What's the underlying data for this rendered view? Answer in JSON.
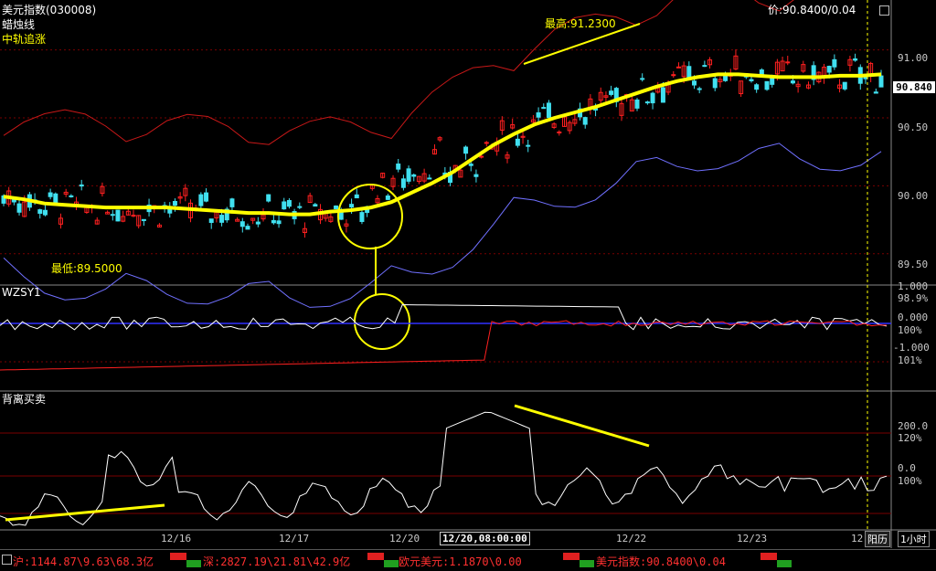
{
  "colors": {
    "bg": "#000000",
    "up": "#ff2020",
    "down": "#40e0f0",
    "ma": "#ffff00",
    "upper_band": "#c81818",
    "lower_band": "#7070ff",
    "indicator_white": "#ffffff",
    "highlight": "#ffff00",
    "grid": "#7a0000"
  },
  "header": {
    "title": "美元指数(030008)",
    "sub1": "蜡烛线",
    "sub2": "中轨追涨",
    "price": "价:90.8400/0.04"
  },
  "annotations": {
    "high": "最高:91.2300",
    "low": "最低:89.5000"
  },
  "current_price_tag": "90.840",
  "panel2": {
    "title": "WZSY1",
    "ticks": [
      "1.000",
      "98.9%",
      "0.000",
      "100%",
      "-1.000",
      "101%"
    ]
  },
  "panel3": {
    "title": "背离买卖",
    "ticks": [
      "200.0",
      "120%",
      "0.0",
      "100%"
    ]
  },
  "bottom_right": {
    "period_btn": "阳历",
    "period": "1小时"
  },
  "statusbar": [
    {
      "text": "沪:1144.87\\9.63\\68.3亿",
      "icon": "market-icon"
    },
    {
      "text": "深:2827.19\\21.81\\42.9亿",
      "icon": "market-icon"
    },
    {
      "text": "欧元美元:1.1870\\0.00",
      "icon": "market-icon"
    },
    {
      "text": "美元指数:90.8400\\0.04",
      "icon": "market-icon"
    }
  ],
  "chart_data": [
    {
      "type": "line",
      "title": "美元指数(030008)",
      "y_ticks": [
        "91.00",
        "90.50",
        "90.00",
        "89.50"
      ],
      "ylim": [
        89.35,
        91.3
      ],
      "x_ticks": [
        "12/16",
        "12/17",
        "12/20",
        "12/20,08:00:00",
        "12/22",
        "12/23",
        "12"
      ],
      "series": [
        {
          "name": "中轨追涨",
          "values": [
            89.92,
            89.9,
            89.87,
            89.86,
            89.85,
            89.84,
            89.84,
            89.84,
            89.84,
            89.83,
            89.82,
            89.81,
            89.8,
            89.8,
            89.79,
            89.79,
            89.81,
            89.82,
            89.84,
            89.88,
            89.95,
            90.02,
            90.1,
            90.2,
            90.3,
            90.38,
            90.45,
            90.5,
            90.54,
            90.58,
            90.63,
            90.68,
            90.73,
            90.77,
            90.8,
            90.82,
            90.82,
            90.81,
            90.8,
            90.8,
            90.8,
            90.81,
            90.81,
            90.82
          ]
        }
      ],
      "annotations": [
        "最高:91.2300",
        "最低:89.5000"
      ]
    },
    {
      "type": "line",
      "title": "WZSY1",
      "ticks": [
        "1.000",
        "98.9%",
        "0.000",
        "100%",
        "-1.000",
        "101%"
      ]
    },
    {
      "type": "line",
      "title": "背离买卖",
      "ticks": [
        "200.0",
        "120%",
        "0.0",
        "100%"
      ]
    }
  ]
}
